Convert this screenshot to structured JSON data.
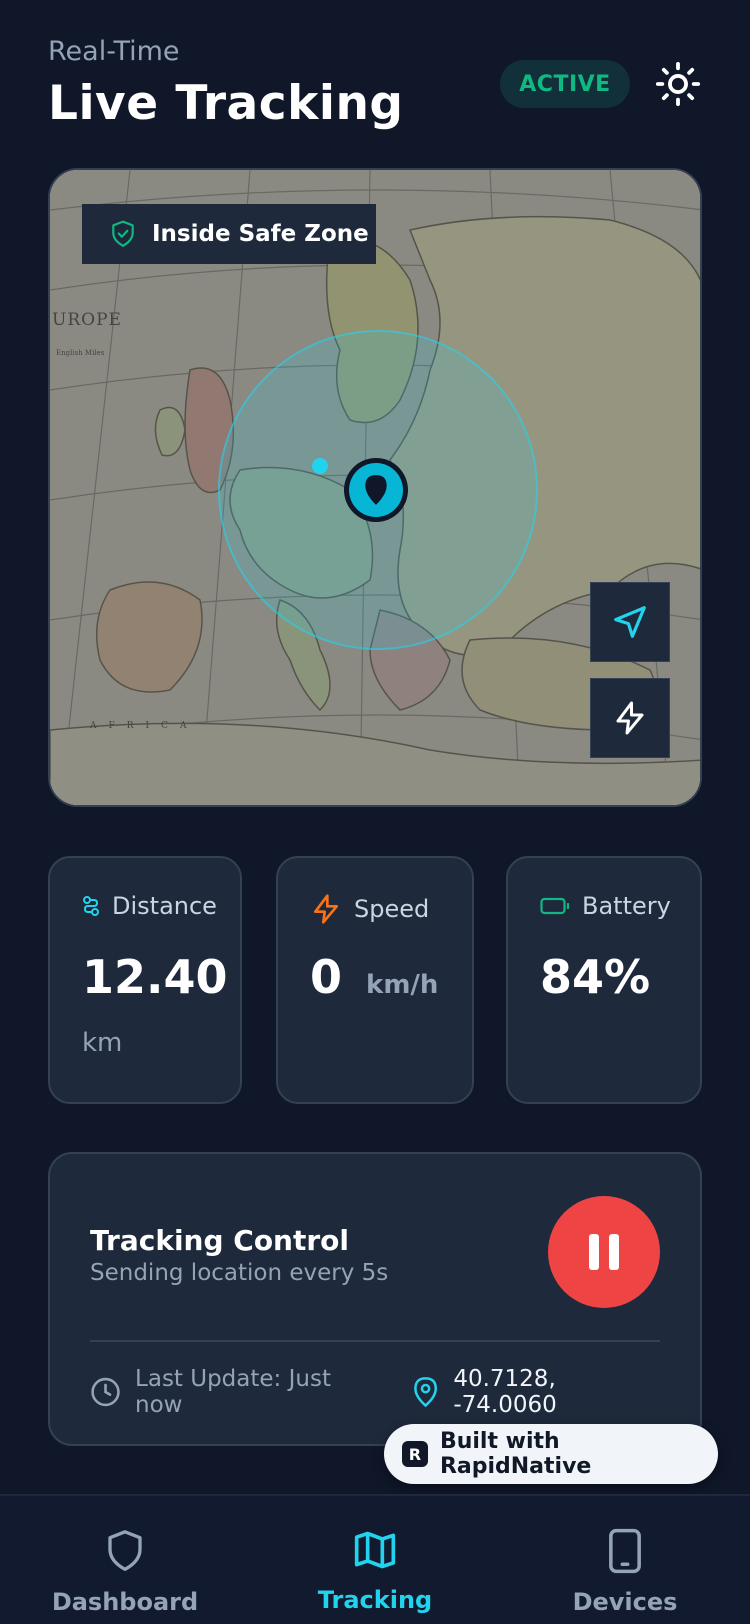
{
  "header": {
    "subtitle": "Real-Time",
    "title": "Live Tracking",
    "status": "ACTIVE"
  },
  "map": {
    "safe_zone_label": "Inside Safe Zone",
    "labels": {
      "europe": "UROPE",
      "africa": "AFRICA",
      "scale": "English Miles"
    }
  },
  "stats": [
    {
      "label": "Distance",
      "value": "12.40",
      "unit": "km",
      "icon": "route-icon",
      "color": "#22d3ee"
    },
    {
      "label": "Speed",
      "value": "0",
      "unit": "km/h",
      "icon": "lightning-icon",
      "color": "#f97316"
    },
    {
      "label": "Battery",
      "value": "84%",
      "unit": "",
      "icon": "battery-icon",
      "color": "#10b981"
    }
  ],
  "control": {
    "title": "Tracking Control",
    "subtitle": "Sending location every 5s",
    "last_update": "Last Update: Just now",
    "coordinates": "40.7128, -74.0060"
  },
  "badge": {
    "logo": "R",
    "text": "Built with RapidNative"
  },
  "tabs": [
    {
      "label": "Dashboard",
      "icon": "shield-icon",
      "active": false
    },
    {
      "label": "Tracking",
      "icon": "map-icon",
      "active": true
    },
    {
      "label": "Devices",
      "icon": "phone-icon",
      "active": false
    }
  ],
  "colors": {
    "background": "#0f1729",
    "card": "#1e293b",
    "accent": "#22d3ee",
    "active": "#10b981",
    "danger": "#ef4444",
    "inactive_tab": "#94a3b8"
  }
}
